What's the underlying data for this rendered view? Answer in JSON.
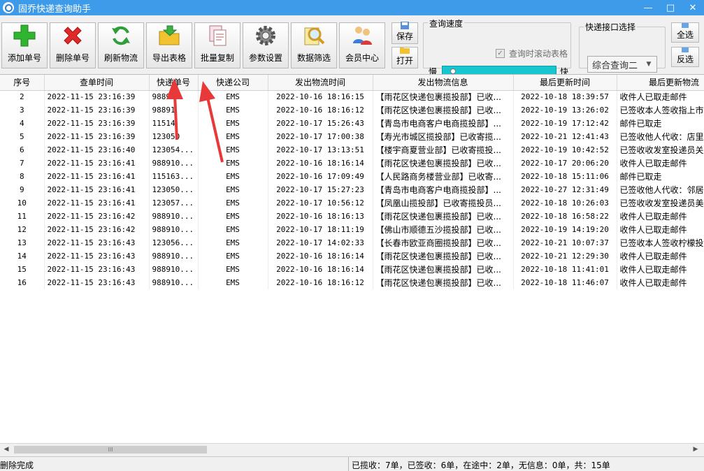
{
  "window": {
    "title": "固乔快递查询助手",
    "controls": [
      "—",
      "□",
      "✕"
    ]
  },
  "toolbar": {
    "add": "添加单号",
    "delete": "删除单号",
    "refresh": "刷新物流",
    "export": "导出表格",
    "copy": "批量复制",
    "settings": "参数设置",
    "filter": "数据筛选",
    "member": "会员中心",
    "save": "保存",
    "open": "打开",
    "query_speed": {
      "label": "查询速度",
      "scroll_checkbox": "查询时滚动表格",
      "slow": "慢",
      "fast": "快",
      "level": 0.05
    },
    "api_select": {
      "label": "快递接口选择",
      "value": "综合查询二"
    },
    "select_all": "全选",
    "invert": "反选"
  },
  "colors": {
    "titlebar": "#3d9be9",
    "arrow": "#e8393a",
    "slider": "#17c6cf"
  },
  "table": {
    "columns": [
      "序号",
      "查单时间",
      "快递单号",
      "快递公司",
      "发出物流时间",
      "发出物流信息",
      "最后更新时间",
      "最后更新物流"
    ],
    "rows": [
      [
        "2",
        "2022-11-15 23:16:39",
        "98891",
        "EMS",
        "2022-10-16 18:16:15",
        "【雨花区快递包裹揽投部】已收...",
        "2022-10-18 18:39:57",
        "收件人已取走邮件"
      ],
      [
        "3",
        "2022-11-15 23:16:39",
        "98891",
        "EMS",
        "2022-10-16 18:16:12",
        "【雨花区快递包裹揽投部】已收...",
        "2022-10-19 13:26:02",
        "已签收本人签收指上市"
      ],
      [
        "4",
        "2022-11-15 23:16:39",
        "11514",
        "EMS",
        "2022-10-17 15:26:43",
        "【青岛市电商客户电商揽投部】...",
        "2022-10-19 17:12:42",
        "邮件已取走"
      ],
      [
        "5",
        "2022-11-15 23:16:39",
        "123050",
        "EMS",
        "2022-10-17 17:00:38",
        "【寿光市城区揽投部】已收寄揽...",
        "2022-10-21 12:41:43",
        "已签收他人代收：店里"
      ],
      [
        "6",
        "2022-11-15 23:16:40",
        "123054...",
        "EMS",
        "2022-10-17 13:13:51",
        "【楼宇商夏营业部】已收寄揽投...",
        "2022-10-19 10:42:52",
        "已签收收发室投递员关"
      ],
      [
        "7",
        "2022-11-15 23:16:41",
        "988910...",
        "EMS",
        "2022-10-16 18:16:14",
        "【雨花区快递包裹揽投部】已收...",
        "2022-10-17 20:06:20",
        "收件人已取走邮件"
      ],
      [
        "8",
        "2022-11-15 23:16:41",
        "115163...",
        "EMS",
        "2022-10-16 17:09:49",
        "【人民路商务楼营业部】已收寄...",
        "2022-10-18 15:11:06",
        "邮件已取走"
      ],
      [
        "9",
        "2022-11-15 23:16:41",
        "123050...",
        "EMS",
        "2022-10-17 15:27:23",
        "【青岛市电商客户电商揽投部】...",
        "2022-10-27 12:31:49",
        "已签收他人代收：邻居"
      ],
      [
        "10",
        "2022-11-15 23:16:41",
        "123057...",
        "EMS",
        "2022-10-17 10:56:12",
        "【凤凰山揽投部】已收寄揽投员...",
        "2022-10-18 10:26:03",
        "已签收收发室投递员美"
      ],
      [
        "11",
        "2022-11-15 23:16:42",
        "988910...",
        "EMS",
        "2022-10-16 18:16:13",
        "【雨花区快递包裹揽投部】已收...",
        "2022-10-18 16:58:22",
        "收件人已取走邮件"
      ],
      [
        "12",
        "2022-11-15 23:16:42",
        "988910...",
        "EMS",
        "2022-10-17 18:11:19",
        "【佛山市顺德五沙揽投部】已收...",
        "2022-10-19 14:19:20",
        "收件人已取走邮件"
      ],
      [
        "13",
        "2022-11-15 23:16:43",
        "123056...",
        "EMS",
        "2022-10-17 14:02:33",
        "【长春市欧亚商圈揽投部】已收...",
        "2022-10-21 10:07:37",
        "已签收本人签收柠檬投"
      ],
      [
        "14",
        "2022-11-15 23:16:43",
        "988910...",
        "EMS",
        "2022-10-16 18:16:14",
        "【雨花区快递包裹揽投部】已收...",
        "2022-10-21 12:29:30",
        "收件人已取走邮件"
      ],
      [
        "15",
        "2022-11-15 23:16:43",
        "988910...",
        "EMS",
        "2022-10-16 18:16:14",
        "【雨花区快递包裹揽投部】已收...",
        "2022-10-18 11:41:01",
        "收件人已取走邮件"
      ],
      [
        "16",
        "2022-11-15 23:16:43",
        "988910...",
        "EMS",
        "2022-10-16 18:16:12",
        "【雨花区快递包裹揽投部】已收...",
        "2022-10-18 11:46:07",
        "收件人已取走邮件"
      ]
    ]
  },
  "scrollbar": {
    "thumb_grip": "III",
    "left": "◀",
    "right": "▶"
  },
  "status": {
    "left": "删除完成",
    "right": "已揽收：7单，已签收：6单，在途中：2单，无信息：0单，共：15单"
  }
}
